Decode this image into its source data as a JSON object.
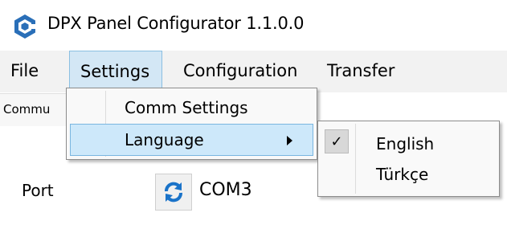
{
  "window": {
    "title": "DPX Panel Configurator 1.1.0.0"
  },
  "menubar": {
    "items": [
      {
        "label": "File"
      },
      {
        "label": "Settings"
      },
      {
        "label": "Configuration"
      },
      {
        "label": "Transfer"
      }
    ]
  },
  "settings_menu": {
    "items": [
      {
        "label": "Comm Settings"
      },
      {
        "label": "Language",
        "has_submenu": true
      }
    ]
  },
  "language_submenu": {
    "items": [
      {
        "label": "English",
        "checked": true,
        "check_glyph": "✓"
      },
      {
        "label": "Türkçe",
        "checked": false
      }
    ]
  },
  "communication_group": {
    "tab_label": "Commu"
  },
  "port": {
    "label": "Port",
    "value": "COM3"
  },
  "colors": {
    "menubar_bg": "#f2f2f2",
    "highlight_bg": "#cde8fa",
    "highlight_border": "#7ab6e0",
    "icon_blue": "#1a73c9"
  },
  "icons": {
    "app": "app-logo-icon",
    "refresh": "refresh-icon",
    "submenu_arrow": "chevron-right-icon",
    "check": "checkmark-icon"
  }
}
